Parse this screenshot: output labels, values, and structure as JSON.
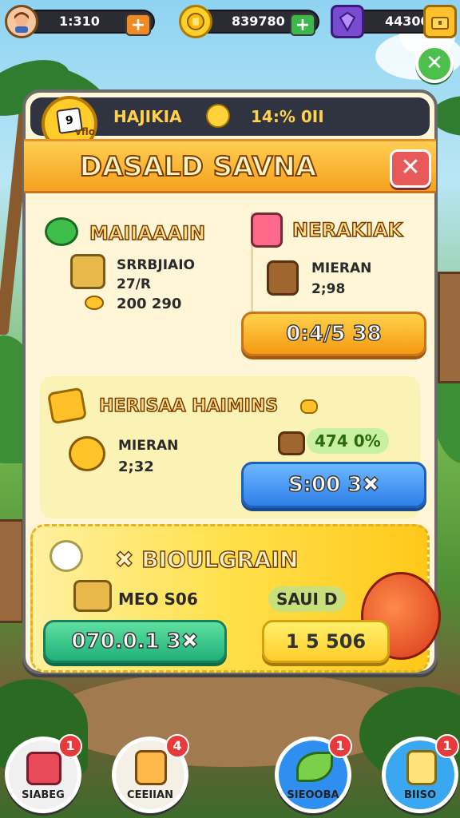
{
  "topbar": {
    "lives": {
      "value": "1:310",
      "icon": "avatar-icon"
    },
    "coins": {
      "value": "839780",
      "icon": "coin-icon"
    },
    "gems": {
      "value": "44300",
      "icon": "gem-icon"
    }
  },
  "header": {
    "name": "HAJIKIA",
    "stat": "14:% 0II",
    "card_text": "9",
    "card_tag": "vflo"
  },
  "title": "DASALD SAVNA",
  "left_offer": {
    "title": "MAIIAAAIN",
    "item_label": "SRRBJIAIO",
    "item_sub": "27/R",
    "value": "200 290"
  },
  "right_offer": {
    "title": "NERAKIAK",
    "item_label": "MIERAN",
    "item_sub": "2;98",
    "button": "0:4/5 38"
  },
  "middle": {
    "title": "HERISAA HAIMINS",
    "item_label": "MIERAN",
    "item_sub": "2;32",
    "bonus": "474 0%",
    "button": "S:00 3✖"
  },
  "special": {
    "title": "✖ BIOULGRAIN",
    "item_value": "MEO S06",
    "tag": "SAUI D",
    "button_left": "070.0.1 3✖",
    "button_right": "1 5 506"
  },
  "bottom_nav": [
    {
      "label": "SIABEG",
      "badge": "1",
      "icon": "gift-box-icon"
    },
    {
      "label": "CEEIIAN",
      "badge": "4",
      "icon": "drink-icon"
    },
    {
      "label": "SIEOOBA",
      "badge": "1",
      "icon": "leaf-icon"
    },
    {
      "label": "BIISO",
      "badge": "1",
      "icon": "crystal-icon"
    }
  ]
}
